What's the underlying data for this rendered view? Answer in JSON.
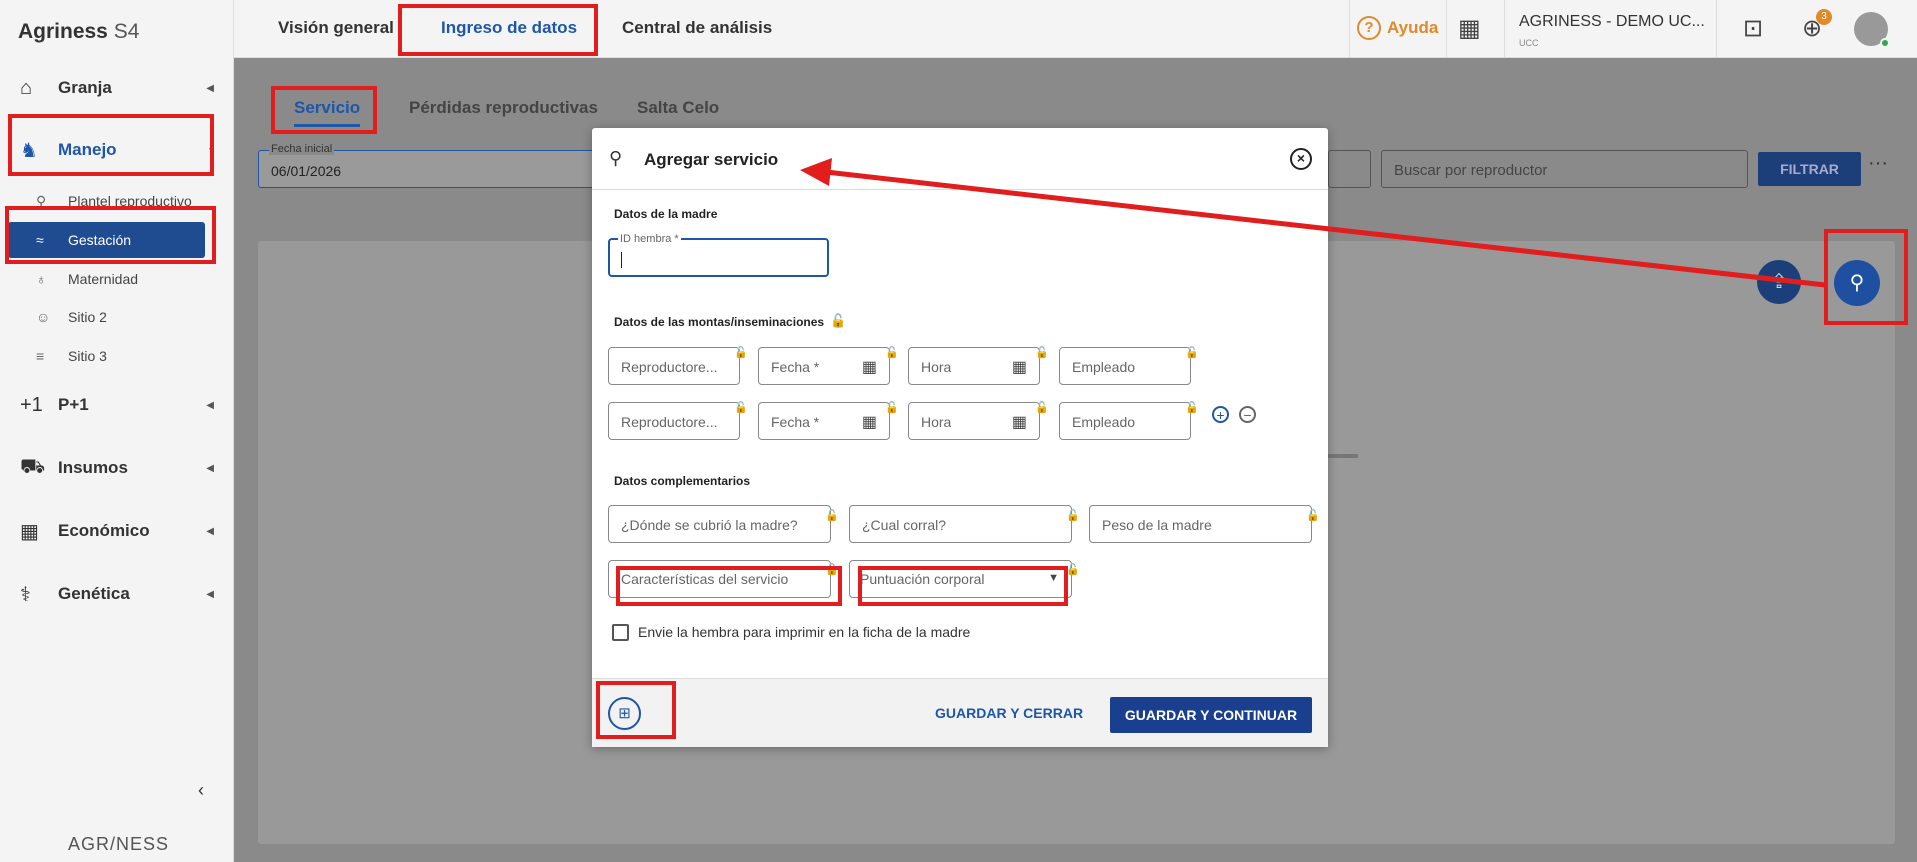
{
  "sidebar": {
    "brand": "Agriness",
    "brand_sub": "S4",
    "items": [
      {
        "label": "Granja",
        "icon": "home-icon"
      },
      {
        "label": "Manejo",
        "icon": "pig-icon"
      },
      {
        "label": "P+1",
        "icon": "plus-one-icon"
      },
      {
        "label": "Insumos",
        "icon": "cart-icon"
      },
      {
        "label": "Económico",
        "icon": "table-icon"
      },
      {
        "label": "Genética",
        "icon": "dna-icon"
      }
    ],
    "sub_items": [
      {
        "label": "Plantel reproductivo"
      },
      {
        "label": "Gestación"
      },
      {
        "label": "Maternidad"
      },
      {
        "label": "Sitio 2"
      },
      {
        "label": "Sitio 3"
      }
    ],
    "footer_logo": "AGR/NESS"
  },
  "topbar": {
    "tabs": [
      "Visión general",
      "Ingreso de datos",
      "Central de análisis"
    ],
    "help": "Ayuda",
    "org_name": "AGRINESS - DEMO UC...",
    "org_sub": "UCC",
    "download_badge": "3"
  },
  "content": {
    "subtabs": [
      "Servicio",
      "Pérdidas reproductivas",
      "Salta Celo"
    ],
    "date_label": "Fecha inicial",
    "date_value": "06/01/2026",
    "search_placeholder": "Buscar por reproductor",
    "filter": "FILTRAR"
  },
  "modal": {
    "title": "Agregar servicio",
    "section_mother": "Datos de la madre",
    "id_label": "ID hembra *",
    "section_mounts": "Datos de las montas/inseminaciones",
    "mount_fields": [
      "Reproductore...",
      "Fecha *",
      "Hora",
      "Empleado"
    ],
    "section_extra": "Datos complementarios",
    "extra_fields": [
      "¿Dónde se cubrió la madre?",
      "¿Cual corral?",
      "Peso de la madre",
      "Características del servicio",
      "Puntuación corporal"
    ],
    "checkbox_label": "Envie la hembra para imprimir en la ficha de la madre",
    "save_close": "GUARDAR Y CERRAR",
    "save_continue": "GUARDAR Y CONTINUAR"
  },
  "colors": {
    "accent": "#1e56a8",
    "annotation": "#e11d1d",
    "help": "#e08a2b"
  }
}
